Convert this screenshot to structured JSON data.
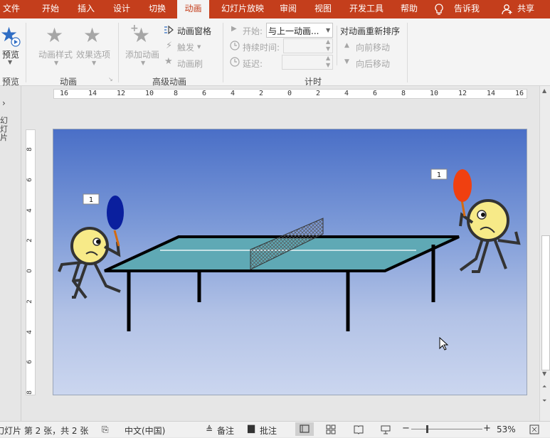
{
  "tabs": [
    "文件",
    "开始",
    "插入",
    "设计",
    "切换",
    "动画",
    "幻灯片放映",
    "审阅",
    "视图",
    "开发工具",
    "帮助",
    "告诉我",
    "共享"
  ],
  "ribbon": {
    "preview": "预览",
    "anim_styles": "动画样式",
    "effect_options": "效果选项",
    "add_anim": "添加动画",
    "anim_pane": "动画窗格",
    "trigger": "触发",
    "anim_painter": "动画刷",
    "start_label": "开始:",
    "start_value": "与上一动画...",
    "duration_label": "持续时间:",
    "delay_label": "延迟:",
    "reorder_title": "对动画重新排序",
    "move_earlier": "向前移动",
    "move_later": "向后移动",
    "groups": {
      "preview": "预览",
      "animation": "动画",
      "advanced": "高级动画",
      "timing": "计时"
    }
  },
  "left_pane_label": "幻灯片",
  "ruler": {
    "h_labels": [
      "16",
      "14",
      "12",
      "10",
      "8",
      "6",
      "4",
      "2",
      "0",
      "2",
      "4",
      "6",
      "8",
      "10",
      "12",
      "14",
      "16"
    ],
    "v_labels": [
      "8",
      "6",
      "4",
      "2",
      "0",
      "2",
      "4",
      "6",
      "8"
    ]
  },
  "slide": {
    "tag_left": "1",
    "tag_right": "1"
  },
  "status": {
    "slide_info": "幻灯片 第 2 张，共 2 张",
    "language": "中文(中国)",
    "notes": "备注",
    "comments": "批注",
    "zoom": "53%"
  },
  "colors": {
    "accent": "#c43e1c",
    "paddle_blue": "#0a1f9e",
    "paddle_red": "#f04010",
    "table": "#5fa9b5"
  }
}
